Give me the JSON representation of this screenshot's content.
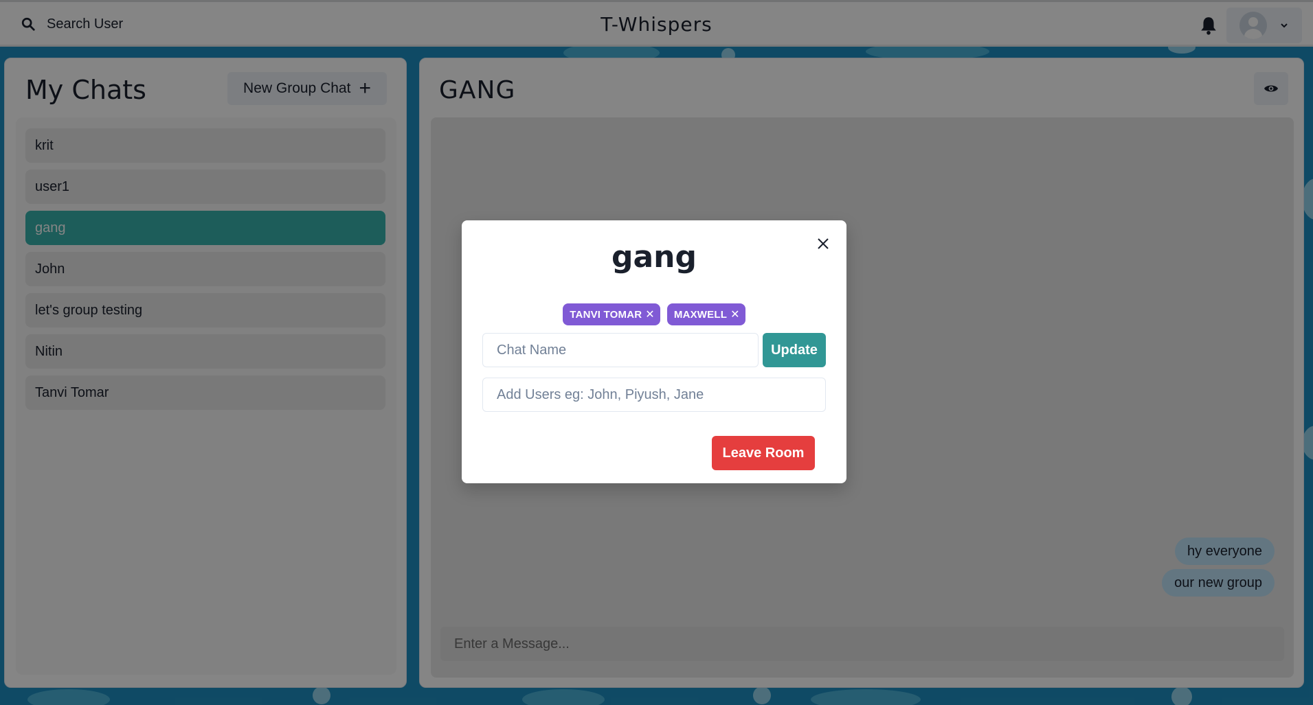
{
  "header": {
    "search_label": "Search User",
    "app_title": "T-Whispers"
  },
  "sidebar": {
    "title": "My Chats",
    "new_group_label": "New Group Chat",
    "chats": [
      {
        "name": "krit",
        "active": false
      },
      {
        "name": "user1",
        "active": false
      },
      {
        "name": "gang",
        "active": true
      },
      {
        "name": "John",
        "active": false
      },
      {
        "name": "let's group testing",
        "active": false
      },
      {
        "name": "Nitin",
        "active": false
      },
      {
        "name": "Tanvi Tomar",
        "active": false
      }
    ]
  },
  "chat": {
    "title": "GANG",
    "messages": [
      "hy everyone",
      "our new group"
    ],
    "input_placeholder": "Enter a Message..."
  },
  "modal": {
    "title": "gang",
    "members": [
      "TANVI TOMAR",
      "MAXWELL"
    ],
    "chat_name_placeholder": "Chat Name",
    "update_label": "Update",
    "add_users_placeholder": "Add Users eg: John, Piyush, Jane",
    "leave_label": "Leave Room"
  },
  "colors": {
    "accent_teal": "#38b2ac",
    "badge_purple": "#805ad5",
    "danger_red": "#e53e3e",
    "message_bubble": "#bee3f8",
    "background_blue": "#1e8fc2"
  }
}
